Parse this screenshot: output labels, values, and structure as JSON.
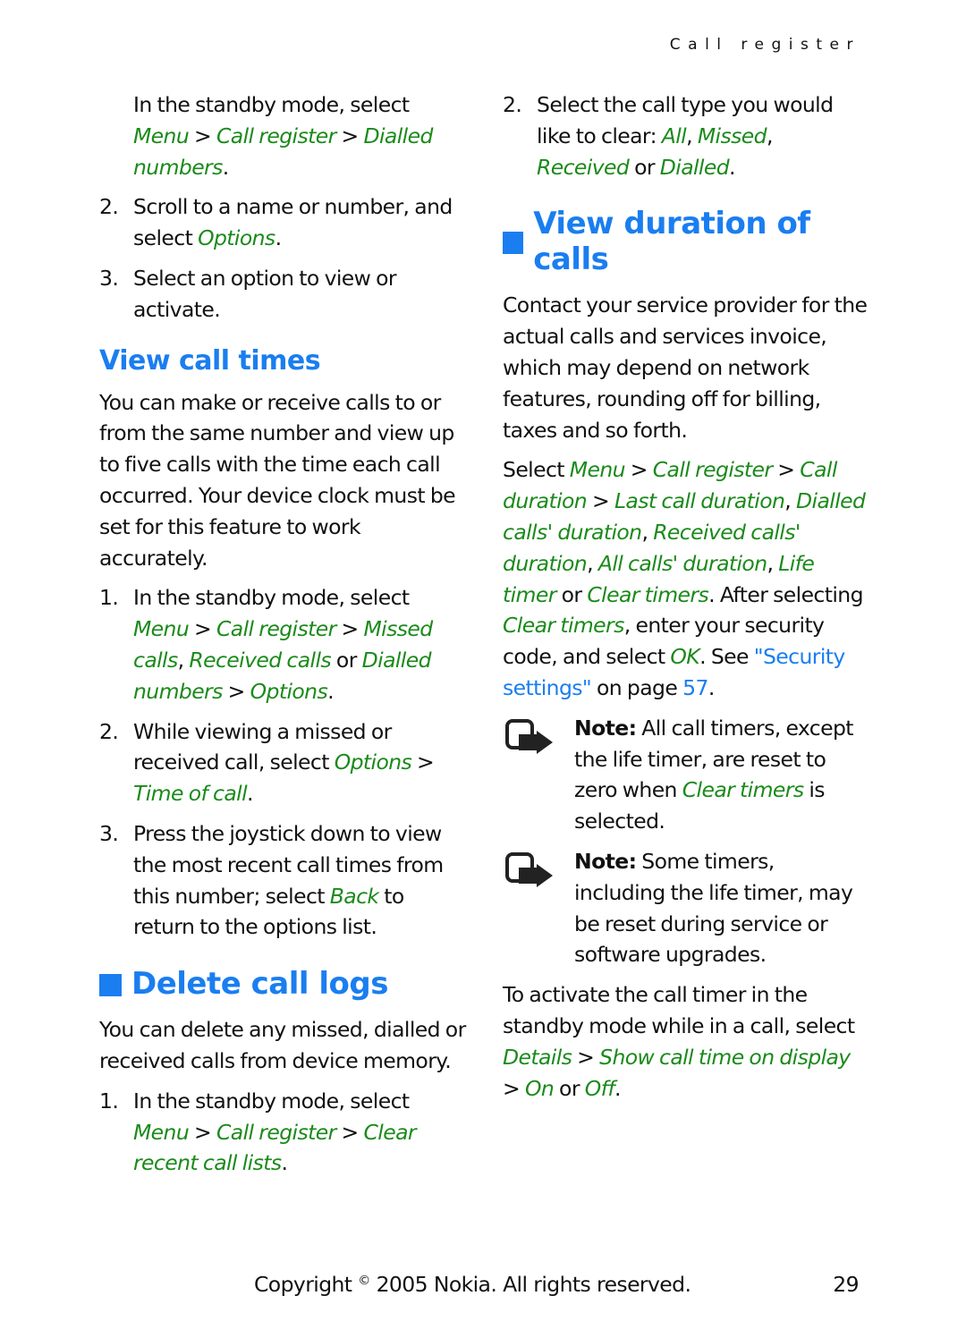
{
  "running_head": "Call register",
  "left": {
    "intro_step": {
      "text": "In the standby mode, select",
      "path": [
        "Menu",
        "Call register",
        "Dialled numbers"
      ]
    },
    "intro_steps": [
      {
        "num": "2.",
        "pre": "Scroll to a name or number, and select ",
        "em": "Options",
        "post": "."
      },
      {
        "num": "3.",
        "text": "Select an option to view or activate."
      }
    ],
    "view_call_times": {
      "heading": "View call times",
      "body": "You can make or receive calls to or from the same number and view up to five calls with the time each call occurred. Your device clock must be set for this feature to work accurately.",
      "steps": [
        {
          "num": "1.",
          "text": "In the standby mode, select",
          "menu": "Menu",
          "sep": ">",
          "call_register": "Call register",
          "missed": "Missed calls",
          "received": "Received calls",
          "or": "or",
          "dialled": "Dialled numbers",
          "options": "Options"
        },
        {
          "num": "2.",
          "text": "While viewing a missed or received call, select ",
          "options": "Options",
          "sep": ">",
          "time_of_call": "Time of call"
        },
        {
          "num": "3.",
          "pre": "Press the joystick down to view the most recent call times from this number; select ",
          "em": "Back",
          "post": " to return to the options list."
        }
      ]
    },
    "delete_call_logs": {
      "heading": "Delete call logs",
      "body": "You can delete any missed, dialled or received calls from device memory.",
      "steps": [
        {
          "num": "1.",
          "text": "In the standby mode, select",
          "menu": "Menu",
          "call_register": "Call register",
          "clear": "Clear recent call lists"
        }
      ]
    }
  },
  "right": {
    "delete_step2": {
      "num": "2.",
      "text": "Select the call type you would like to clear: ",
      "options": [
        "All",
        "Missed",
        "Received",
        "Dialled"
      ],
      "or": "or"
    },
    "view_duration": {
      "heading": "View duration of calls",
      "body": "Contact your service provider for the actual calls and services invoice, which may depend on network features, rounding off for billing, taxes and so forth.",
      "select_para": {
        "select": "Select",
        "menu": "Menu",
        "call_register": "Call register",
        "call_duration": "Call duration",
        "last": "Last call duration",
        "dialled": "Dialled calls' duration",
        "received": "Received calls' duration",
        "all": "All calls' duration",
        "life": "Life timer",
        "or": "or",
        "clear": "Clear timers",
        "after": "After selecting",
        "clear2": "Clear timers",
        "enter": ", enter your security code, and select ",
        "ok": "OK",
        "see": ". See ",
        "link": "\"Security settings\"",
        "on_page": " on page ",
        "page": "57"
      },
      "notes": [
        {
          "label": "Note:",
          "pre": " All call timers, except the life timer, are reset to zero when ",
          "em": "Clear timers",
          "post": " is selected."
        },
        {
          "label": "Note:",
          "text": " Some timers, including the life timer, may be reset during service or software upgrades."
        }
      ],
      "activate": {
        "text": "To activate the call timer in the standby mode while in a call, select ",
        "details": "Details",
        "show": "Show call time on display",
        "on": "On",
        "or": "or",
        "off": "Off"
      }
    }
  },
  "footer": {
    "copyright_pre": "Copyright ",
    "copyright_sym": "©",
    "copyright_post": " 2005 Nokia. All rights reserved.",
    "page_number": "29"
  },
  "colors": {
    "heading": "#1a7ef0",
    "menu_path": "#1a8a1a",
    "link": "#1a7ef0",
    "text": "#111111"
  }
}
